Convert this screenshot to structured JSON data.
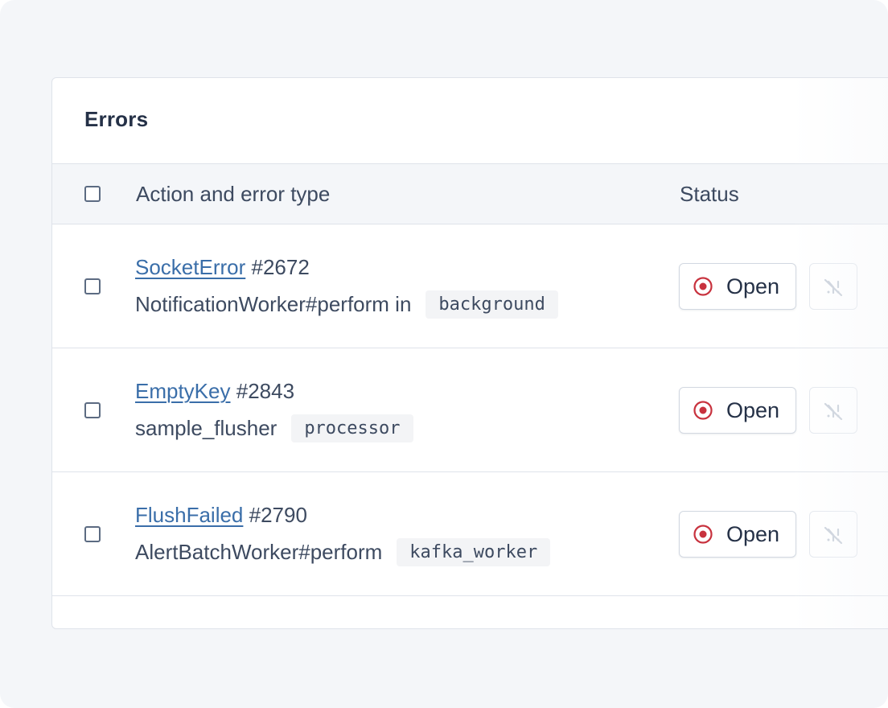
{
  "card": {
    "title": "Errors"
  },
  "table": {
    "headers": {
      "action": "Action and error type",
      "status": "Status"
    },
    "rows": [
      {
        "error_name": "SocketError",
        "error_id": "#2672",
        "action": "NotificationWorker#perform in",
        "namespace": "background",
        "status": "Open"
      },
      {
        "error_name": "EmptyKey",
        "error_id": "#2843",
        "action": "sample_flusher",
        "namespace": "processor",
        "status": "Open"
      },
      {
        "error_name": "FlushFailed",
        "error_id": "#2790",
        "action": "AlertBatchWorker#perform",
        "namespace": "kafka_worker",
        "status": "Open"
      }
    ]
  },
  "icons": {
    "status": "open-status-icon",
    "mute": "bell-slash-icon",
    "checkbox": "checkbox-unchecked"
  },
  "colors": {
    "link": "#3a6ea9",
    "open_status": "#c8323e",
    "text": "#3d4a60",
    "background": "#f4f6f9"
  }
}
